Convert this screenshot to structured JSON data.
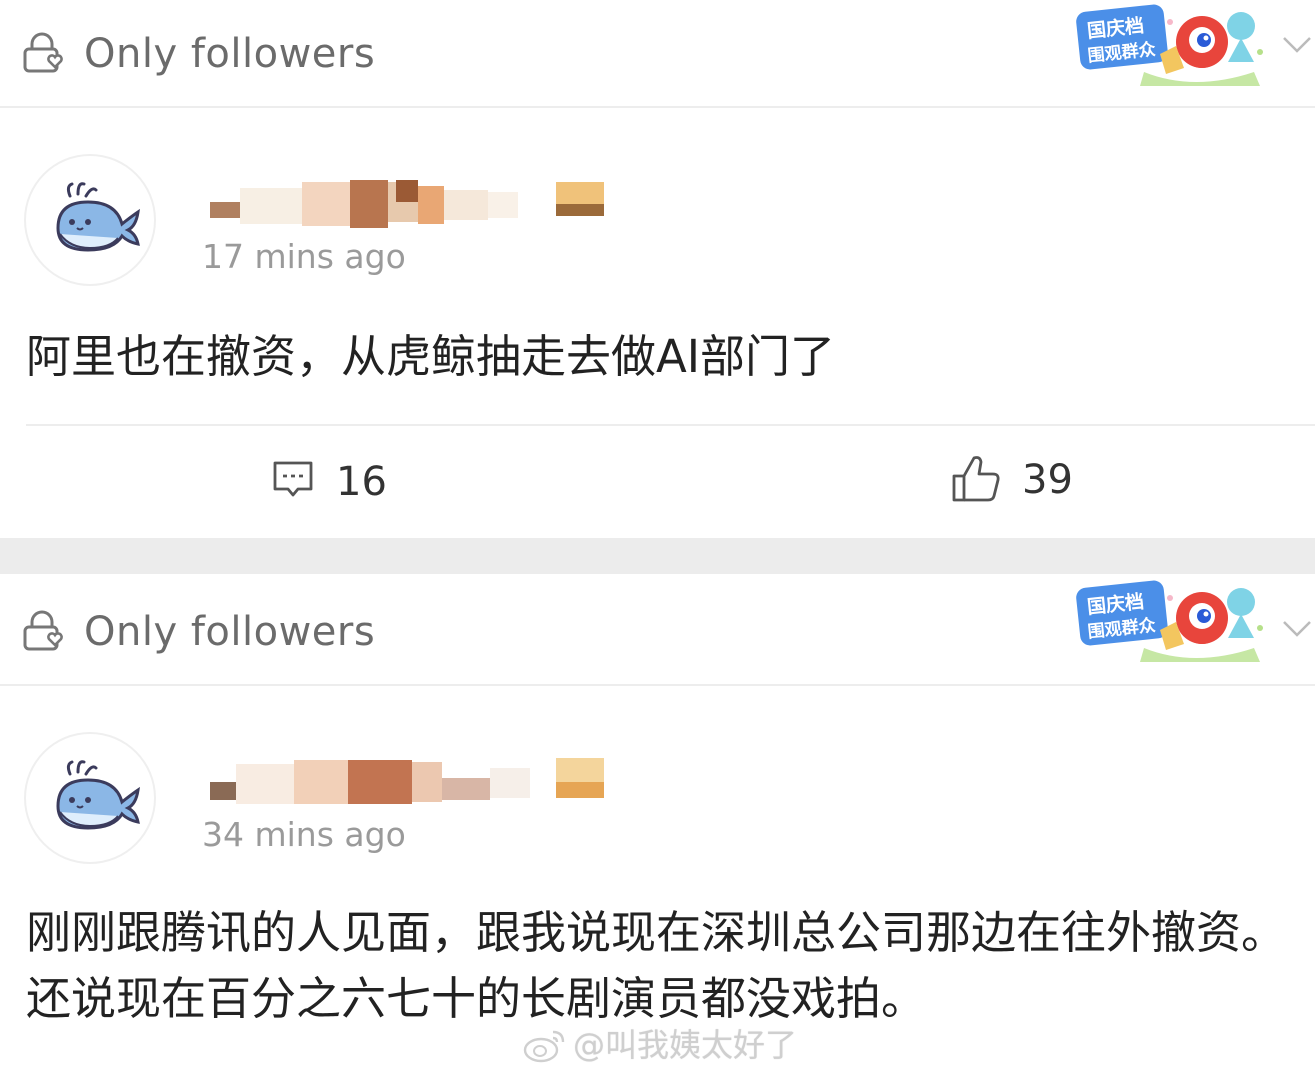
{
  "posts": [
    {
      "visibility_label": "Only followers",
      "time": "17 mins ago",
      "text": "阿里也在撤资，从虎鲸抽走去做AI部门了",
      "comments": "16",
      "likes": "39"
    },
    {
      "visibility_label": "Only followers",
      "time": "34 mins ago",
      "text": "刚刚跟腾讯的人见面，跟我说现在深圳总公司那边在往外撤资。还说现在百分之六七十的长剧演员都没戏拍。"
    }
  ],
  "badge": {
    "text_line1": "国庆档",
    "text_line2": "围观群众"
  },
  "watermark": "@叫我姨太好了",
  "icons": [
    "lock-heart-icon",
    "chevron-down-icon",
    "whale-avatar-icon",
    "comment-icon",
    "thumbs-up-icon",
    "weibo-logo-icon"
  ],
  "colors": {
    "separator": "#ececec",
    "muted_text": "#6b6b6b",
    "timestamp": "#9a9a9a",
    "whale": "#8bb7e6"
  }
}
